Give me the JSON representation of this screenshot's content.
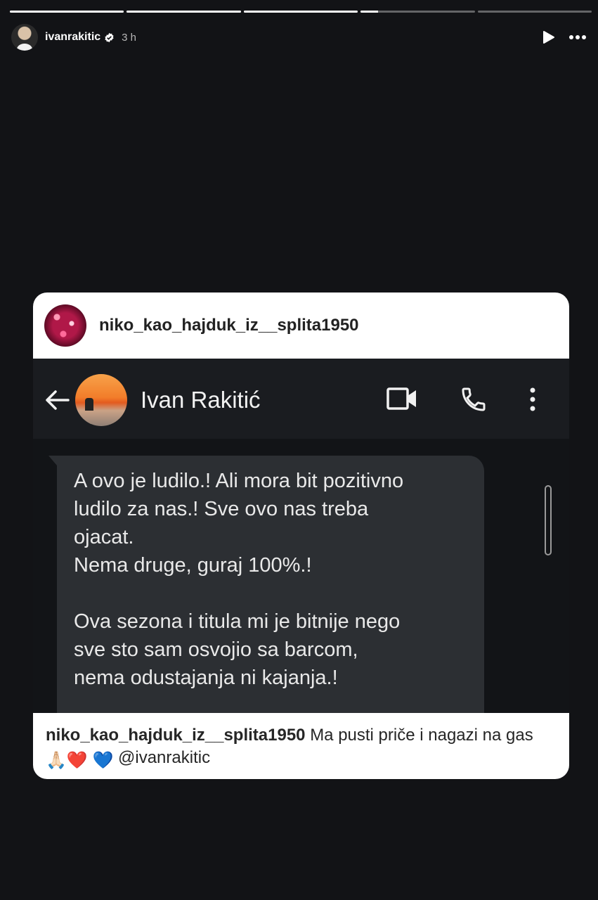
{
  "story": {
    "username": "ivanrakitic",
    "time": "3 h",
    "progress": [
      1,
      1,
      1,
      0.15,
      0
    ]
  },
  "shared_post": {
    "author": "niko_kao_hajduk_iz__splita1950",
    "screenshot": {
      "contact_name": "Ivan Rakitić",
      "message": "A ovo je ludilo.! Ali mora bit pozitivno\nludilo za nas.! Sve ovo nas treba\nojacat.\nNema druge, guraj 100%.!\n\nOva sezona i titula mi je bitnije nego\nsve sto sam osvojio sa barcom,\nnema odustajanja ni kajanja.!"
    },
    "caption": {
      "author": "niko_kao_hajduk_iz__splita1950",
      "text_before": "Ma pusti priče i nagazi na gas",
      "emojis": [
        "🙏🏻",
        "❤️",
        "💙"
      ],
      "mention": "@ivanrakitic"
    }
  },
  "colors": {
    "background": "#121316",
    "card": "#ffffff",
    "bubble": "#2c2f33"
  },
  "icons": [
    "verified-badge-icon",
    "play-icon",
    "more-options-icon",
    "back-arrow-icon",
    "video-call-icon",
    "phone-icon",
    "kebab-menu-icon"
  ]
}
